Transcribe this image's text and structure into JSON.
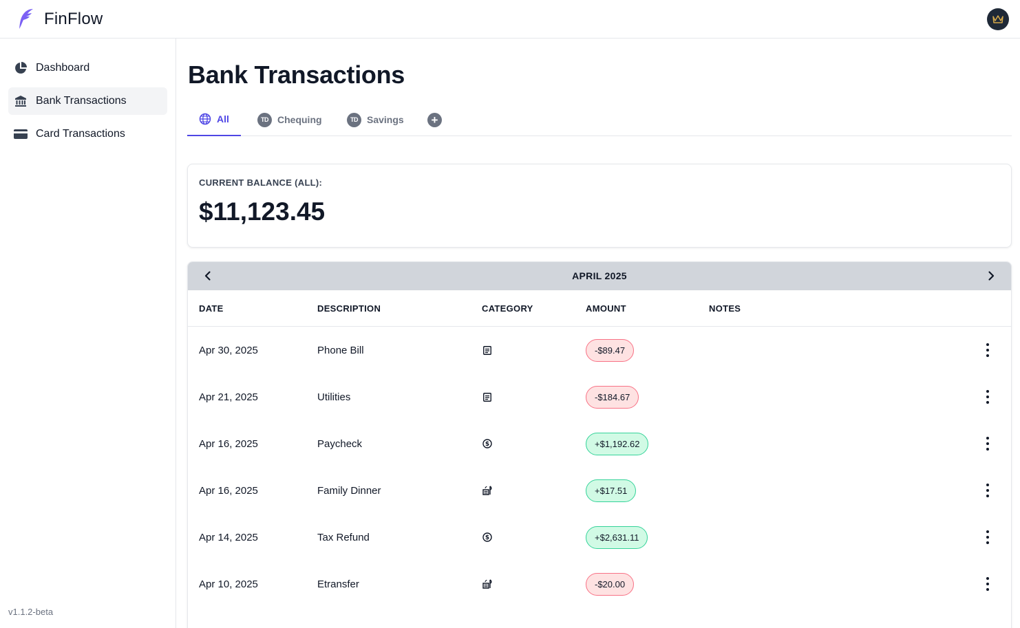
{
  "app": {
    "name": "FinFlow",
    "version": "v1.1.2-beta",
    "brand_color": "#6366f1"
  },
  "sidebar": {
    "items": [
      {
        "label": "Dashboard",
        "icon": "pie-chart-icon",
        "active": false
      },
      {
        "label": "Bank Transactions",
        "icon": "bank-icon",
        "active": true
      },
      {
        "label": "Card Transactions",
        "icon": "credit-card-icon",
        "active": false
      }
    ]
  },
  "page": {
    "title": "Bank Transactions"
  },
  "tabs": [
    {
      "label": "All",
      "icon": "globe-icon",
      "active": true
    },
    {
      "label": "Chequing",
      "icon": "td-bank-icon",
      "badge": "TD",
      "active": false
    },
    {
      "label": "Savings",
      "icon": "td-bank-icon",
      "badge": "TD",
      "active": false
    },
    {
      "label": "",
      "icon": "plus-icon",
      "active": false
    }
  ],
  "balance": {
    "label": "CURRENT BALANCE (ALL):",
    "value": "$11,123.45"
  },
  "month": {
    "label": "APRIL 2025"
  },
  "table": {
    "headers": [
      "DATE",
      "DESCRIPTION",
      "CATEGORY",
      "AMOUNT",
      "NOTES"
    ],
    "rows": [
      {
        "date": "Apr 30, 2025",
        "description": "Phone Bill",
        "category_icon": "receipt-icon",
        "amount": "-$89.47",
        "type": "neg",
        "notes": ""
      },
      {
        "date": "Apr 21, 2025",
        "description": "Utilities",
        "category_icon": "receipt-icon",
        "amount": "-$184.67",
        "type": "neg",
        "notes": ""
      },
      {
        "date": "Apr 16, 2025",
        "description": "Paycheck",
        "category_icon": "dollar-coin-icon",
        "amount": "+$1,192.62",
        "type": "pos",
        "notes": ""
      },
      {
        "date": "Apr 16, 2025",
        "description": "Family Dinner",
        "category_icon": "food-icon",
        "amount": "+$17.51",
        "type": "pos",
        "notes": ""
      },
      {
        "date": "Apr 14, 2025",
        "description": "Tax Refund",
        "category_icon": "dollar-coin-icon",
        "amount": "+$2,631.11",
        "type": "pos",
        "notes": ""
      },
      {
        "date": "Apr 10, 2025",
        "description": "Etransfer",
        "category_icon": "food-icon",
        "amount": "-$20.00",
        "type": "neg",
        "notes": ""
      }
    ]
  },
  "colors": {
    "accent": "#4f46e5",
    "negative_bg": "#fee2e2",
    "negative_border": "#f87185",
    "positive_bg": "#d1fae5",
    "positive_border": "#34d399"
  }
}
